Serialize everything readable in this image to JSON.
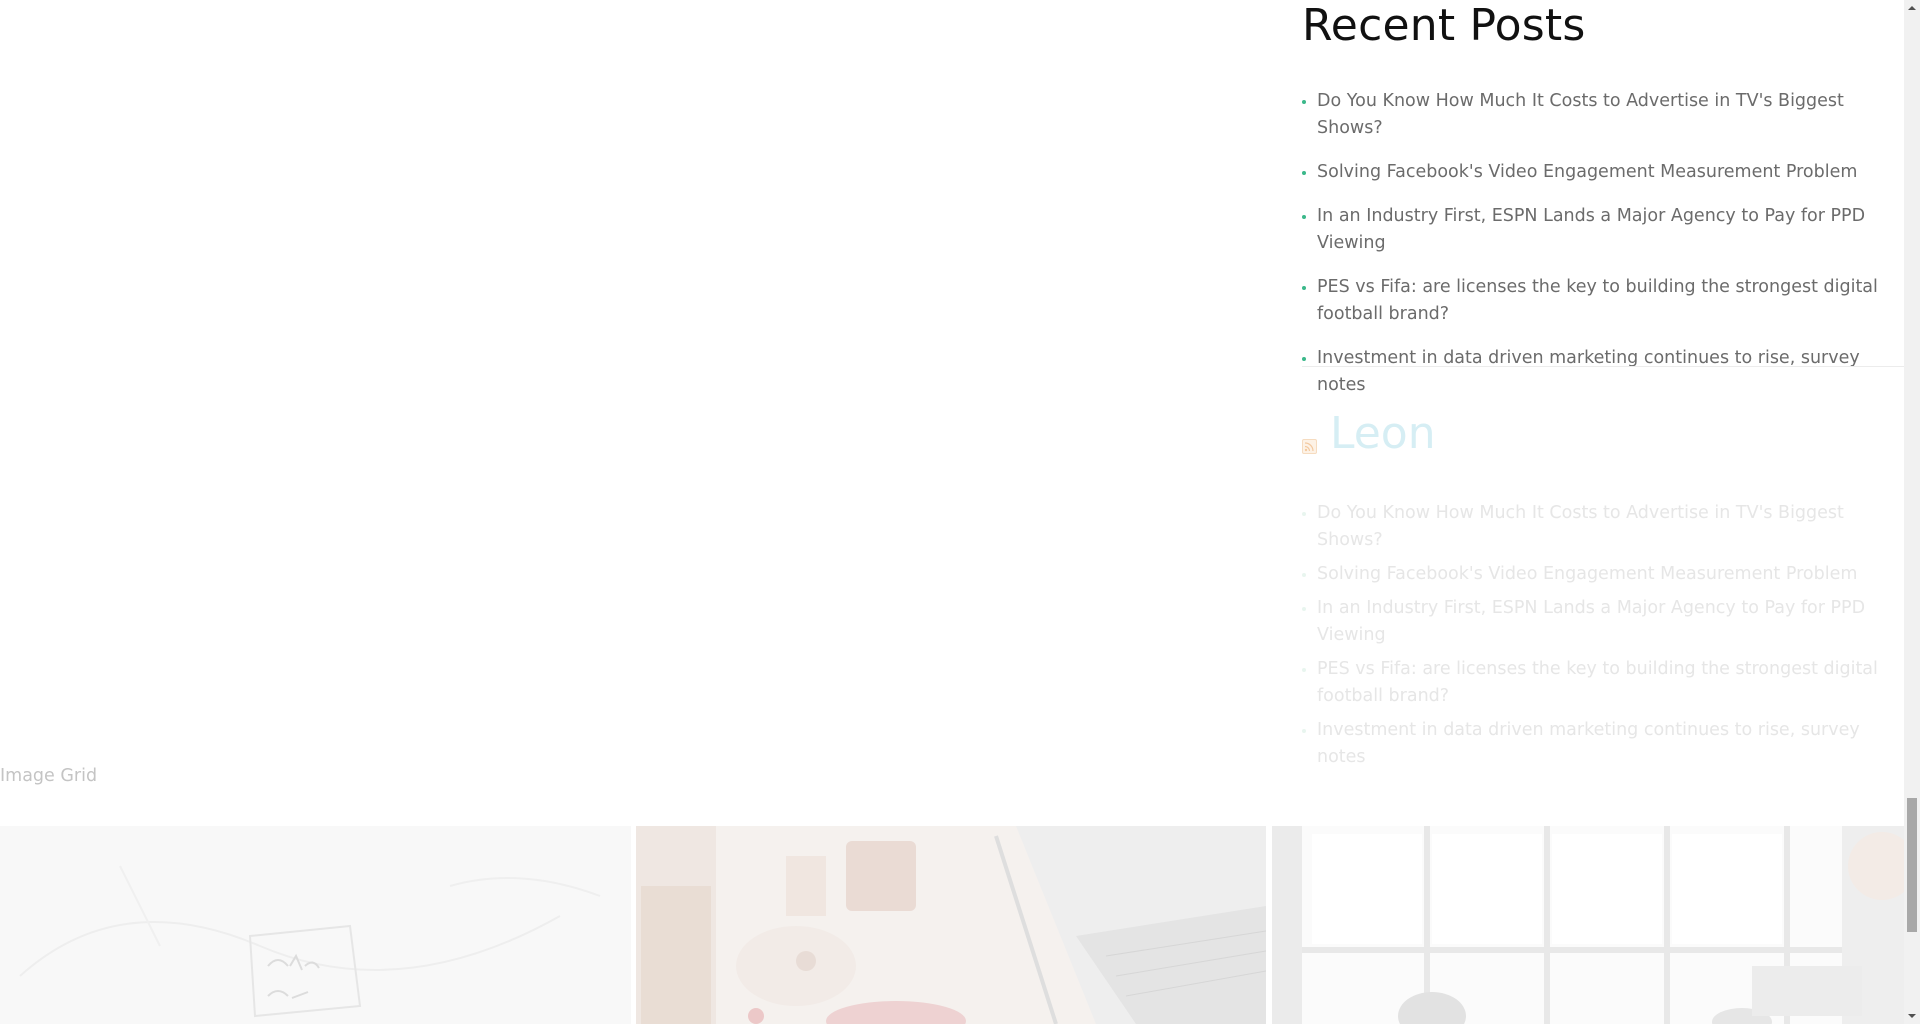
{
  "recent_posts": {
    "title": "Recent Posts",
    "items": [
      {
        "label": "Do You Know How Much It Costs to Advertise in TV's Biggest Shows?"
      },
      {
        "label": "Solving Facebook's Video Engagement Measurement Problem"
      },
      {
        "label": "In an Industry First, ESPN Lands a Major Agency to Pay for PPD Viewing"
      },
      {
        "label": "PES vs Fifa: are licenses the key to building the strongest digital football brand?"
      },
      {
        "label": "Investment in data driven marketing continues to rise, survey notes"
      }
    ]
  },
  "rss_widget": {
    "title": "Leon",
    "icon": "rss-icon",
    "items": [
      {
        "label": "Do You Know How Much It Costs to Advertise in TV's Biggest Shows?"
      },
      {
        "label": "Solving Facebook's Video Engagement Measurement Problem"
      },
      {
        "label": "In an Industry First, ESPN Lands a Major Agency to Pay for PPD Viewing"
      },
      {
        "label": "PES vs Fifa: are licenses the key to building the strongest digital football brand?"
      },
      {
        "label": "Investment in data driven marketing continues to rise, survey notes"
      }
    ]
  },
  "image_grid": {
    "label": "Image Grid",
    "images": [
      {
        "subject": "whiteboard sketch"
      },
      {
        "subject": "desk with laptop and coffee"
      },
      {
        "subject": "office meeting by window"
      }
    ]
  },
  "colors": {
    "accent": "#3bb88a",
    "heading": "#111111",
    "body_text": "#6b6b6b"
  }
}
